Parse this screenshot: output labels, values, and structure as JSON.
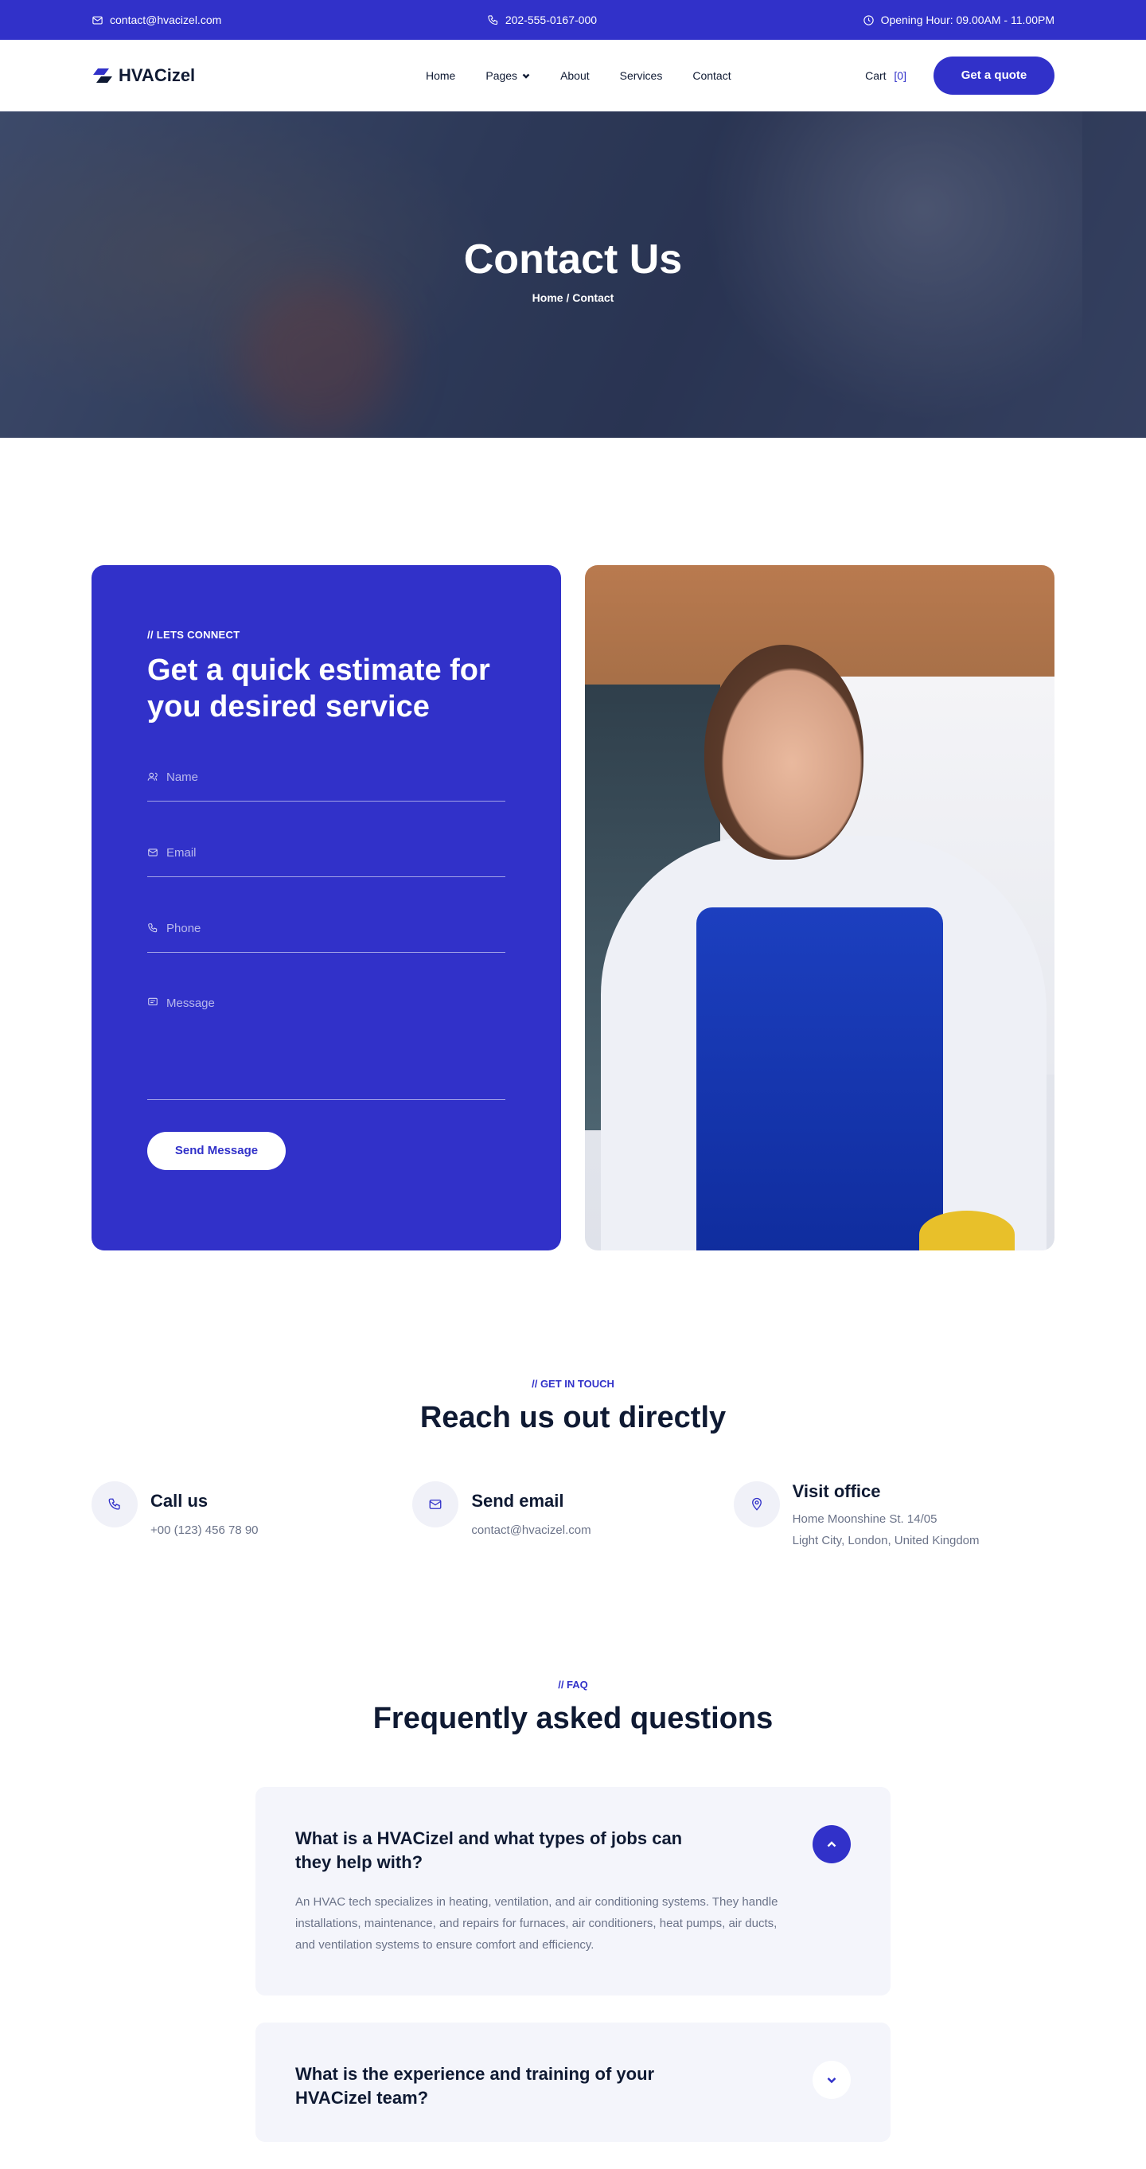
{
  "topbar": {
    "email": "contact@hvacizel.com",
    "phone": "202-555-0167-000",
    "hours": "Opening Hour: 09.00AM - 11.00PM"
  },
  "header": {
    "logo": "HVACizel",
    "nav": [
      "Home",
      "Pages",
      "About",
      "Services",
      "Contact"
    ],
    "cart_label": "Cart",
    "cart_count": "[0]",
    "quote_button": "Get a quote"
  },
  "hero": {
    "title": "Contact Us",
    "breadcrumb": "Home / Contact"
  },
  "form": {
    "eyebrow": "// LETS CONNECT",
    "title": "Get a quick estimate for you desired service",
    "name_placeholder": "Name",
    "email_placeholder": "Email",
    "phone_placeholder": "Phone",
    "message_placeholder": "Message",
    "submit": "Send Message"
  },
  "touch": {
    "eyebrow": "// GET IN TOUCH",
    "title": "Reach us out directly",
    "items": [
      {
        "title": "Call us",
        "line1": "+00 (123) 456 78 90"
      },
      {
        "title": "Send email",
        "line1": "contact@hvacizel.com"
      },
      {
        "title": "Visit office",
        "line1": "Home Moonshine St. 14/05",
        "line2": "Light City, London, United Kingdom"
      }
    ]
  },
  "faq": {
    "eyebrow": "// FAQ",
    "title": "Frequently asked questions",
    "items": [
      {
        "question": "What is a HVACizel and what types of jobs can they help with?",
        "answer": "An HVAC tech specializes in heating, ventilation, and air conditioning systems. They handle installations, maintenance, and repairs for furnaces, air conditioners, heat pumps, air ducts, and ventilation systems to ensure comfort and efficiency."
      },
      {
        "question": "What is the experience and training of your HVACizel team?"
      }
    ]
  }
}
